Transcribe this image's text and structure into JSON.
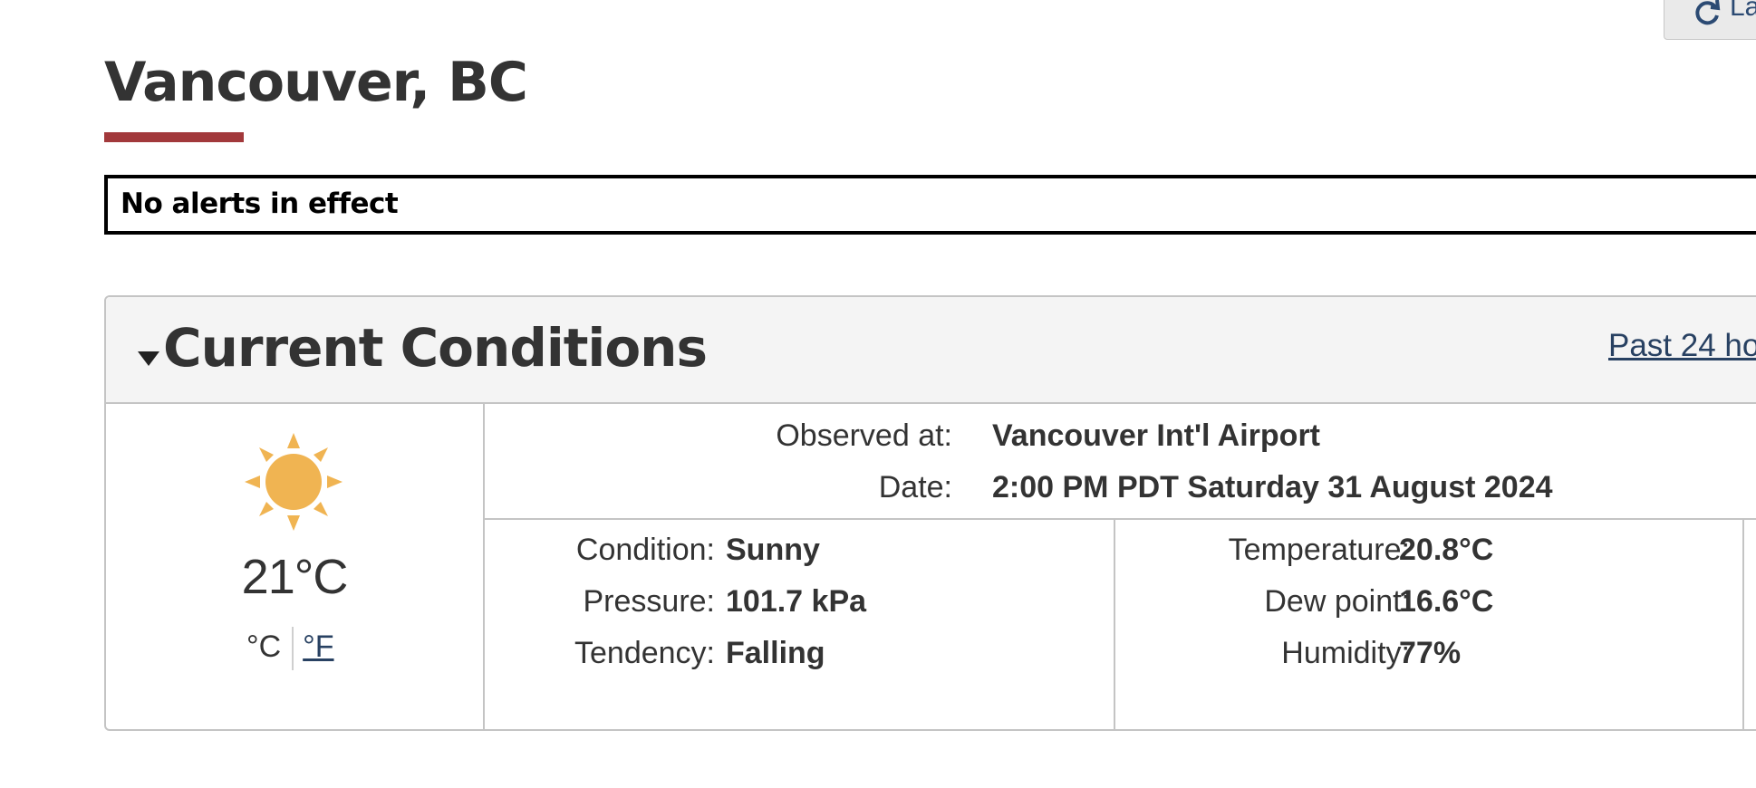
{
  "header": {
    "button_label": "La",
    "title": "Vancouver, BC",
    "alert": "No alerts in effect"
  },
  "current_conditions": {
    "heading": "Current Conditions",
    "past_link": "Past 24 ho",
    "icon": "sun-icon",
    "temperature_big": "21°C",
    "unit_c": "°C",
    "unit_f": "°F",
    "observed_label": "Observed at:",
    "observed_value": "Vancouver Int'l Airport",
    "date_label": "Date:",
    "date_value": "2:00 PM PDT Saturday 31 August 2024",
    "left_details": [
      {
        "label": "Condition:",
        "value": "Sunny"
      },
      {
        "label": "Pressure:",
        "value": "101.7 kPa"
      },
      {
        "label": "Tendency:",
        "value": "Falling"
      }
    ],
    "right_details": [
      {
        "label": "Temperature:",
        "value": "20.8°C"
      },
      {
        "label": "Dew point:",
        "value": "16.6°C"
      },
      {
        "label": "Humidity:",
        "value": "77%"
      }
    ]
  },
  "colors": {
    "accent_bar": "#a2393b",
    "link": "#284162",
    "sun": "#f0b452"
  }
}
